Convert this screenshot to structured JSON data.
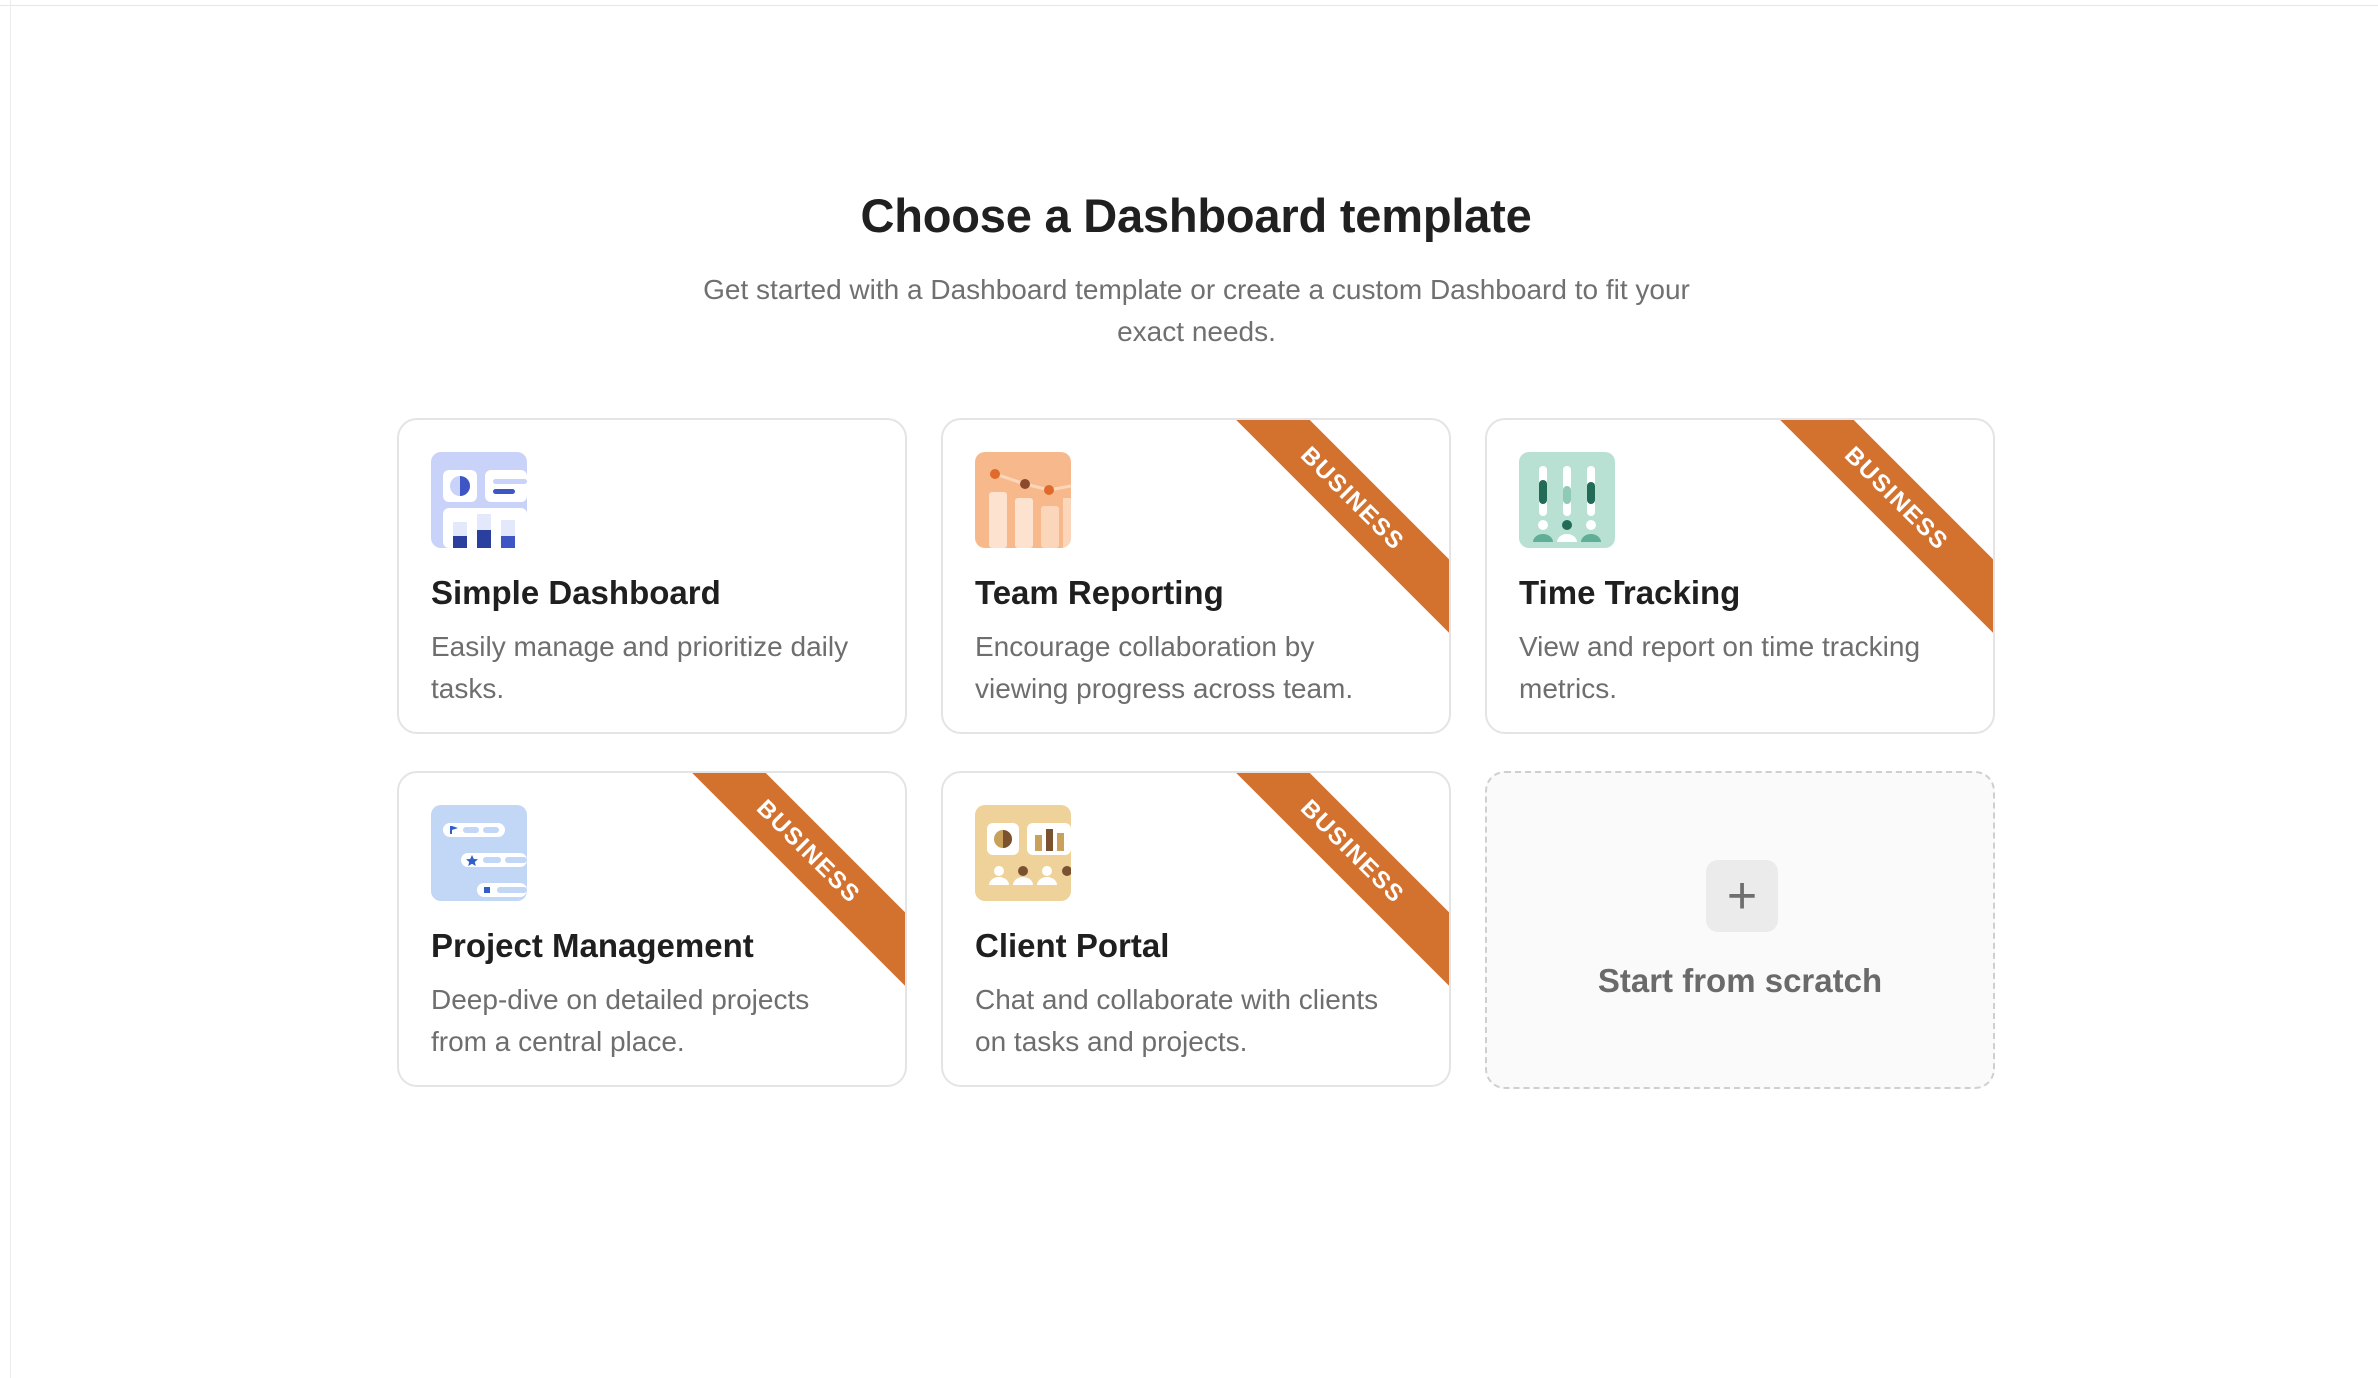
{
  "heading": "Choose a Dashboard template",
  "subheading": "Get started with a Dashboard template or create a custom Dashboard to fit your exact needs.",
  "ribbon_label": "BUSINESS",
  "colors": {
    "ribbon": "#d3722f",
    "card_border": "#e4e4e6"
  },
  "templates": [
    {
      "title": "Simple Dashboard",
      "description": "Easily manage and prioritize daily tasks.",
      "icon": "simple-dashboard-icon",
      "business": false
    },
    {
      "title": "Team Reporting",
      "description": "Encourage collaboration by viewing progress across team.",
      "icon": "team-reporting-icon",
      "business": true
    },
    {
      "title": "Time Tracking",
      "description": "View and report on time tracking metrics.",
      "icon": "time-tracking-icon",
      "business": true
    },
    {
      "title": "Project Management",
      "description": "Deep-dive on detailed projects from a central place.",
      "icon": "project-management-icon",
      "business": true
    },
    {
      "title": "Client Portal",
      "description": "Chat and collaborate with clients on tasks and projects.",
      "icon": "client-portal-icon",
      "business": true
    }
  ],
  "scratch": {
    "label": "Start from scratch",
    "icon": "plus-icon"
  }
}
